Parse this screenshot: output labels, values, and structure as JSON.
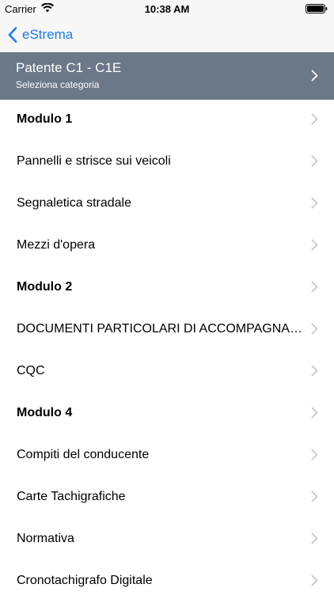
{
  "status_bar": {
    "carrier": "Carrier",
    "time": "10:38 AM"
  },
  "nav": {
    "back_label": "eStrema"
  },
  "category": {
    "title": "Patente C1 - C1E",
    "subtitle": "Seleziona categoria"
  },
  "colors": {
    "accent": "#1a7cf5",
    "header_bg": "#6b7888",
    "chevron": "#c7c7cc"
  },
  "items": [
    {
      "label": "Modulo 1",
      "bold": true
    },
    {
      "label": "Pannelli e strisce sui veicoli",
      "bold": false
    },
    {
      "label": "Segnaletica stradale",
      "bold": false
    },
    {
      "label": "Mezzi d'opera",
      "bold": false
    },
    {
      "label": "Modulo 2",
      "bold": true
    },
    {
      "label": "DOCUMENTI PARTICOLARI DI ACCOMPAGNAMENTO",
      "bold": false
    },
    {
      "label": "CQC",
      "bold": false
    },
    {
      "label": "Modulo 4",
      "bold": true
    },
    {
      "label": "Compiti del conducente",
      "bold": false
    },
    {
      "label": "Carte Tachigrafiche",
      "bold": false
    },
    {
      "label": "Normativa",
      "bold": false
    },
    {
      "label": "Cronotachigrafo Digitale",
      "bold": false
    }
  ]
}
